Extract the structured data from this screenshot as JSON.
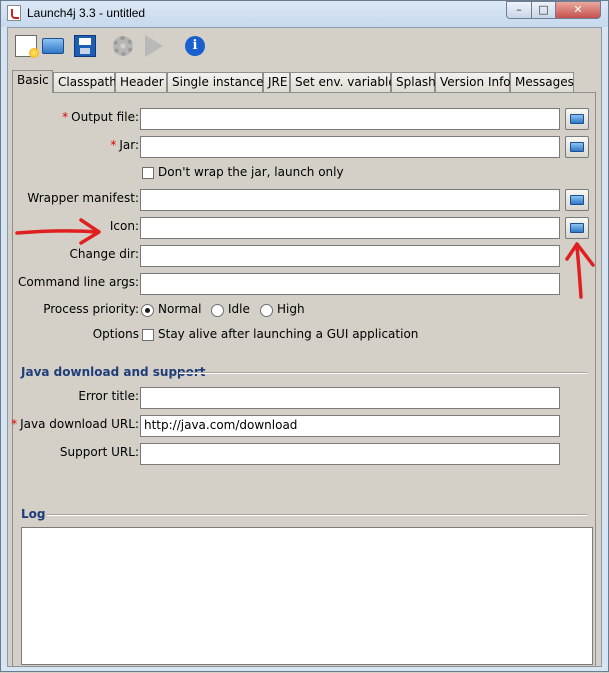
{
  "window": {
    "title": "Launch4j 3.3 - untitled",
    "controls": {
      "minimize": "–",
      "maximize": "□",
      "close": "✕"
    }
  },
  "toolbar": {
    "icons": [
      "new-config-icon",
      "open-folder-icon",
      "save-icon",
      "build-gear-icon",
      "run-icon",
      "about-info-icon"
    ],
    "info_glyph": "i"
  },
  "tabs": [
    "Basic",
    "Classpath",
    "Header",
    "Single instance",
    "JRE",
    "Set env. variables",
    "Splash",
    "Version Info",
    "Messages"
  ],
  "active_tab": "Basic",
  "basic": {
    "required_marker": "*",
    "output_file_label": "Output file:",
    "output_file_value": "",
    "jar_label": "Jar:",
    "jar_value": "",
    "dont_wrap_label": "Don't wrap the jar, launch only",
    "wrapper_manifest_label": "Wrapper manifest:",
    "icon_label": "Icon:",
    "change_dir_label": "Change dir:",
    "cmd_args_label": "Command line args:",
    "process_priority_label": "Process priority:",
    "priorities": [
      "Normal",
      "Idle",
      "High"
    ],
    "selected_priority": "Normal",
    "options_label": "Options",
    "stay_alive_label": "Stay alive after launching a GUI application"
  },
  "java_download": {
    "section_title": "Java download and support",
    "error_title_label": "Error title:",
    "java_download_url_label": "Java download URL:",
    "java_download_url_value": "http://java.com/download",
    "support_url_label": "Support URL:"
  },
  "log": {
    "section_title": "Log",
    "content": ""
  },
  "colors": {
    "annotation": "#e02020",
    "section_heading": "#1e3d79",
    "required": "#d00000"
  }
}
